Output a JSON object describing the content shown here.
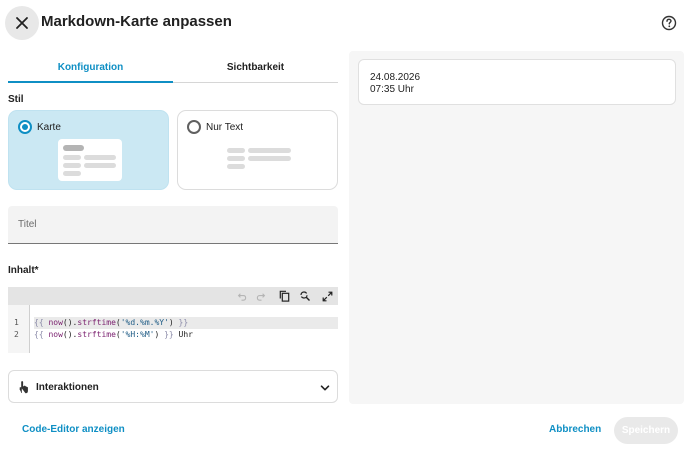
{
  "header": {
    "title": "Markdown-Karte anpassen",
    "close_icon": "close-icon",
    "help_icon": "help-circle-icon"
  },
  "tabs": [
    {
      "label": "Konfiguration",
      "active": true
    },
    {
      "label": "Sichtbarkeit",
      "active": false
    }
  ],
  "style_section": {
    "label": "Stil",
    "options": [
      {
        "label": "Karte",
        "selected": true
      },
      {
        "label": "Nur Text",
        "selected": false
      }
    ]
  },
  "title_field": {
    "placeholder": "Titel",
    "value": ""
  },
  "content_section": {
    "label": "Inhalt*",
    "toolbar_icons": [
      "undo-icon",
      "redo-icon",
      "copy-icon",
      "find-replace-icon",
      "fullscreen-icon"
    ],
    "lines": [
      {
        "number": "1",
        "text": "{{ now().strftime('%d.%m.%Y') }}"
      },
      {
        "number": "2",
        "text": "{{ now().strftime('%H:%M') }} Uhr"
      }
    ]
  },
  "interactions": {
    "label": "Interaktionen",
    "icon": "hand-pointer-icon"
  },
  "preview": {
    "date": "24.08.2026",
    "time": "07:35 Uhr"
  },
  "footer": {
    "code_editor_label": "Code-Editor anzeigen",
    "cancel_label": "Abbrechen",
    "save_label": "Speichern"
  },
  "colors": {
    "accent": "#0f8fc4",
    "selected_card_bg": "#cbe8f3",
    "preview_bg": "#f6f6f6"
  }
}
